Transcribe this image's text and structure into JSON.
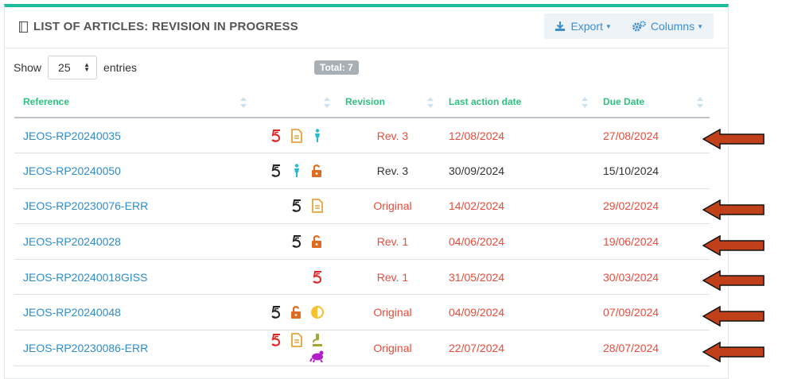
{
  "header": {
    "title": "LIST OF ARTICLES: REVISION IN PROGRESS",
    "export_label": "Export",
    "columns_label": "Columns"
  },
  "controls": {
    "show_label": "Show",
    "page_size": "25",
    "entries_label": "entries",
    "total_label": "Total: 7"
  },
  "table": {
    "columns": [
      "Reference",
      "",
      "Revision",
      "Last action date",
      "Due Date"
    ],
    "rows": [
      {
        "reference": "JEOS-RP20240035",
        "icons": [
          "five-red-icon",
          "document-icon",
          "person-icon"
        ],
        "revision": "Rev. 3",
        "last_action": "12/08/2024",
        "due": "27/08/2024",
        "overdue": true
      },
      {
        "reference": "JEOS-RP20240050",
        "icons": [
          "five-black-icon",
          "person-icon",
          "unlock-icon"
        ],
        "revision": "Rev. 3",
        "last_action": "30/09/2024",
        "due": "15/10/2024",
        "overdue": false
      },
      {
        "reference": "JEOS-RP20230076-ERR",
        "icons": [
          "five-black-icon",
          "document-icon"
        ],
        "revision": "Original",
        "last_action": "14/02/2024",
        "due": "29/02/2024",
        "overdue": true
      },
      {
        "reference": "JEOS-RP20240028",
        "icons": [
          "five-black-icon",
          "unlock-icon"
        ],
        "revision": "Rev. 1",
        "last_action": "04/06/2024",
        "due": "19/06/2024",
        "overdue": true
      },
      {
        "reference": "JEOS-RP20240018GISS",
        "icons": [
          "five-red-icon"
        ],
        "revision": "Rev. 1",
        "last_action": "31/05/2024",
        "due": "30/03/2024",
        "overdue": true
      },
      {
        "reference": "JEOS-RP20240048",
        "icons": [
          "five-black-icon",
          "unlock-icon",
          "half-circle-icon"
        ],
        "revision": "Original",
        "last_action": "04/09/2024",
        "due": "07/09/2024",
        "overdue": true
      },
      {
        "reference": "JEOS-RP20230086-ERR",
        "icons": [
          "five-red-icon",
          "document-icon",
          "microscope-icon",
          "frog-icon"
        ],
        "revision": "Original",
        "last_action": "22/07/2024",
        "due": "28/07/2024",
        "overdue": true
      }
    ]
  },
  "annotations": {
    "arrow_color": "#c0401a",
    "arrow_rows": [
      0,
      2,
      3,
      4,
      5,
      6
    ]
  },
  "colors": {
    "accent": "#1abc9c",
    "link": "#2e8ccf",
    "overdue": "#e74c3c",
    "header_text": "#2ec27e"
  }
}
